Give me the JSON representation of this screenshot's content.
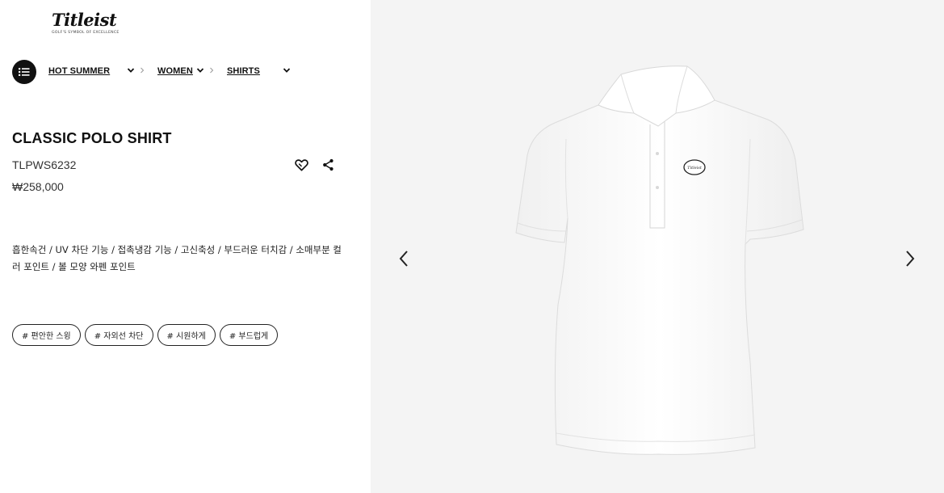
{
  "brand": {
    "logo_text": "Titleist",
    "tagline": "GOLF'S SYMBOL OF EXCELLENCE"
  },
  "breadcrumb": {
    "items": [
      {
        "label": "HOT SUMMER"
      },
      {
        "label": "WOMEN"
      },
      {
        "label": "SHIRTS"
      }
    ]
  },
  "product": {
    "title": "CLASSIC POLO SHIRT",
    "code": "TLPWS6232",
    "price": "₩258,000",
    "description": "흡한속건 / UV 차단 기능 / 접촉냉감 기능 / 고신축성 / 부드러운 터치감 / 소매부분 컬러 포인트 / 볼 모양 와펜 포인트",
    "tags": [
      "# 편안한 스윙",
      "# 자외선 차단",
      "# 시원하게",
      "# 부드럽게"
    ],
    "chest_logo_text": "Titleist"
  },
  "icons": {
    "menu": "list-icon",
    "wishlist": "heart-icon",
    "share": "share-icon",
    "prev": "chevron-left-icon",
    "next": "chevron-right-icon",
    "dropdown": "chevron-down-icon",
    "separator": "chevron-right-small-icon"
  },
  "colors": {
    "accent": "#111111",
    "image_bg": "#f4f4f4"
  }
}
